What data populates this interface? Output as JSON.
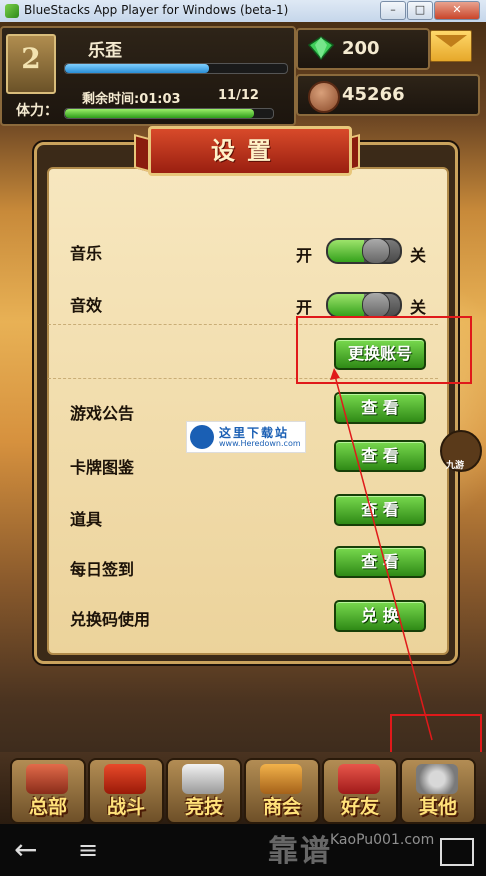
{
  "window": {
    "title": "BlueStacks App Player for Windows (beta-1)",
    "min": "–",
    "max": "□",
    "close": "✕"
  },
  "player": {
    "rank": "2",
    "name": "乐歪",
    "exp_fraction": 0.65,
    "stamina_label": "体力：",
    "remaining_time": "剩余时间:01:03",
    "stamina_count": "11/12",
    "stamina_fraction": 0.91
  },
  "resources": {
    "gems": "200",
    "coins": "45266"
  },
  "dialog": {
    "title": "设置",
    "music_label": "音乐",
    "sound_label": "音效",
    "on": "开",
    "off": "关",
    "music_on": true,
    "sound_on": true,
    "switch_account": "更换账号",
    "rows": [
      {
        "label": "游戏公告",
        "button": "查 看"
      },
      {
        "label": "卡牌图鉴",
        "button": "查 看"
      },
      {
        "label": "道具",
        "button": "查 看"
      },
      {
        "label": "每日签到",
        "button": "查 看"
      },
      {
        "label": "兑换码使用",
        "button": "兑 换"
      }
    ]
  },
  "watermark": {
    "line1": "这里下载站",
    "line2": "www.Heredown.com",
    "mascot": "九游"
  },
  "nav": [
    {
      "label": "总部",
      "icon": "castle-icon"
    },
    {
      "label": "战斗",
      "icon": "flag-icon"
    },
    {
      "label": "竞技",
      "icon": "wings-icon"
    },
    {
      "label": "商会",
      "icon": "chest-icon"
    },
    {
      "label": "好友",
      "icon": "handshake-icon"
    },
    {
      "label": "其他",
      "icon": "gear-icon"
    }
  ],
  "android": {
    "back": "←",
    "menu": "≡",
    "watermark": "靠谱",
    "url": "KaoPu001.com"
  },
  "colors": {
    "annotation": "#e0191a",
    "button_green": "#2f8a16",
    "banner_red": "#9a1f10"
  }
}
